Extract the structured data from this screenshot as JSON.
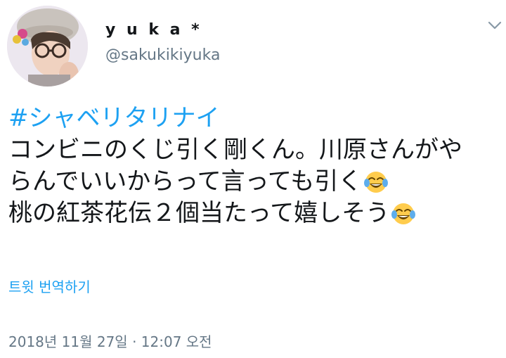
{
  "tweet": {
    "display_name": "y u k a *",
    "handle": "@sakukikiyuka",
    "hashtag": "#シャベリタリナイ",
    "lines": [
      "コンビニのくじ引く剛くん。川原さんがや",
      "らんでいいからって言っても引く",
      "桃の紅茶花伝２個当たって嬉しそう"
    ],
    "emoji": "face-with-tears-of-joy-icon",
    "translate_label": "트윗 번역하기",
    "timestamp": "2018년 11월 27일 · 12:07 오전"
  },
  "colors": {
    "link": "#1da1f2",
    "muted": "#657786",
    "text": "#14171a"
  }
}
